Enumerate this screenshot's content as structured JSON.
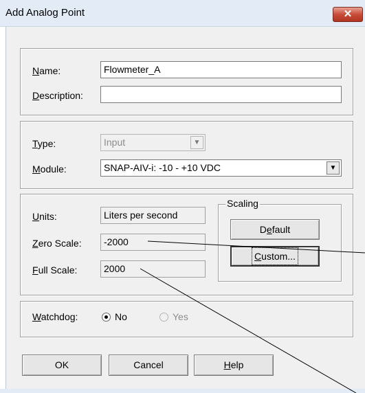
{
  "window": {
    "title": "Add Analog Point",
    "close_glyph": "✕"
  },
  "identity": {
    "name_label_ul": "N",
    "name_label_rest": "ame:",
    "name_value": "Flowmeter_A",
    "description_label_ul": "D",
    "description_label_rest": "escription:",
    "description_value": ""
  },
  "io": {
    "type_label_ul": "T",
    "type_label_rest": "ype:",
    "type_value": "Input",
    "module_label_ul": "M",
    "module_label_rest": "odule:",
    "module_value": "SNAP-AIV-i: -10 - +10 VDC"
  },
  "scale": {
    "units_label_ul": "U",
    "units_label_rest": "nits:",
    "units_value": "Liters per second",
    "zero_label_ul": "Z",
    "zero_label_rest": "ero Scale:",
    "zero_value": "-2000",
    "full_label_ul": "F",
    "full_label_rest": "ull Scale:",
    "full_value": "2000"
  },
  "scaling": {
    "legend": "Scaling",
    "default_pre": "D",
    "default_ul": "e",
    "default_post": "fault",
    "custom_ul": "C",
    "custom_post": "ustom..."
  },
  "watchdog": {
    "label_ul": "W",
    "label_rest": "atchdog:",
    "no_label": "No",
    "yes_label": "Yes",
    "selected": "No"
  },
  "buttons": {
    "ok": "OK",
    "cancel": "Cancel",
    "help_ul": "H",
    "help_rest": "elp"
  },
  "icons": {
    "dropdown": "chevron-down-icon",
    "close": "close-icon"
  },
  "colors": {
    "titlebar": "#e3ecf6",
    "close_button": "#c74d3a",
    "client_bg": "#f0f0f0"
  }
}
